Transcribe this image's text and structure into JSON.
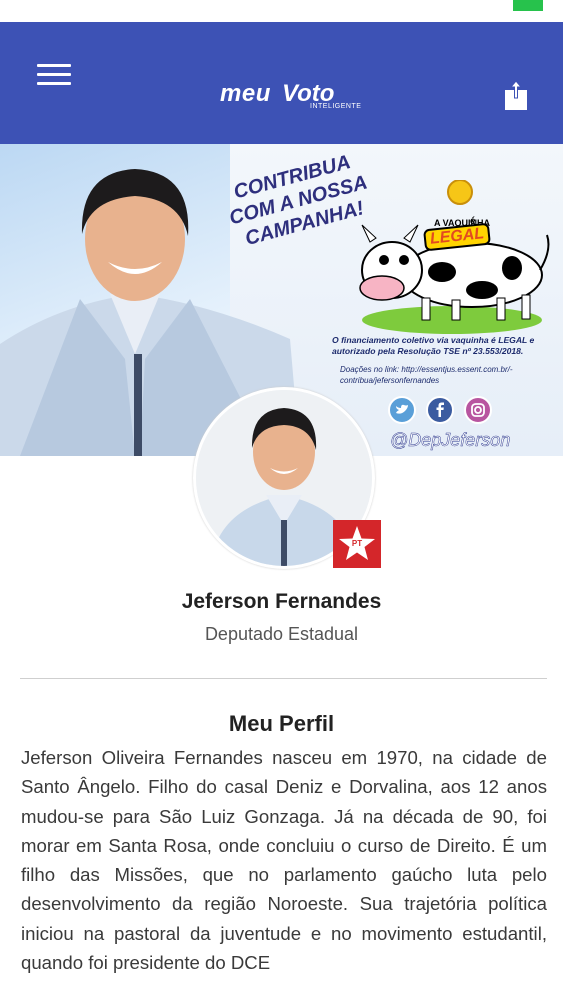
{
  "header": {
    "logo_word1": "meu",
    "logo_word2": "Voto",
    "logo_sub": "INTELIGENTE",
    "menu_icon": "hamburger-icon",
    "share_icon": "share-icon"
  },
  "banner": {
    "call_to_action": "CONTRIBUA COM A NOSSA CAMPANHA!",
    "vaquinha_title": "A VAQUINHA",
    "vaquinha_e": "é",
    "vaquinha_legal": "LEGAL",
    "financing_text": "O financiamento coletivo via vaquinha é LEGAL e autorizado pela Resolução TSE nº 23.553/2018.",
    "donation_text": "Doações no link: http://essentjus.essent.com.br/-contribua/jefersonfernandes",
    "social_icons": [
      "twitter-icon",
      "facebook-icon",
      "instagram-icon"
    ],
    "handle": "@DepJeferson"
  },
  "profile": {
    "party_badge": "PT",
    "name": "Jeferson Fernandes",
    "role": "Deputado Estadual"
  },
  "about": {
    "title": "Meu Perfil",
    "text": "Jeferson Oliveira Fernandes nasceu em 1970, na cidade de Santo Ângelo. Filho do casal Deniz e Dorvalina, aos 12 anos mudou-se para São Luiz Gonzaga. Já na década de 90, foi morar em Santa Rosa, onde concluiu o curso de Direito. É um filho das Missões, que no parlamento gaúcho luta pelo desenvolvimento da região Noroeste. Sua trajetória política iniciou na pastoral da juventude e no movimento estudantil, quando foi presidente do DCE"
  },
  "colors": {
    "header_bg": "#3d52b5",
    "party_red": "#d4262a",
    "status_green": "#27c24c"
  }
}
